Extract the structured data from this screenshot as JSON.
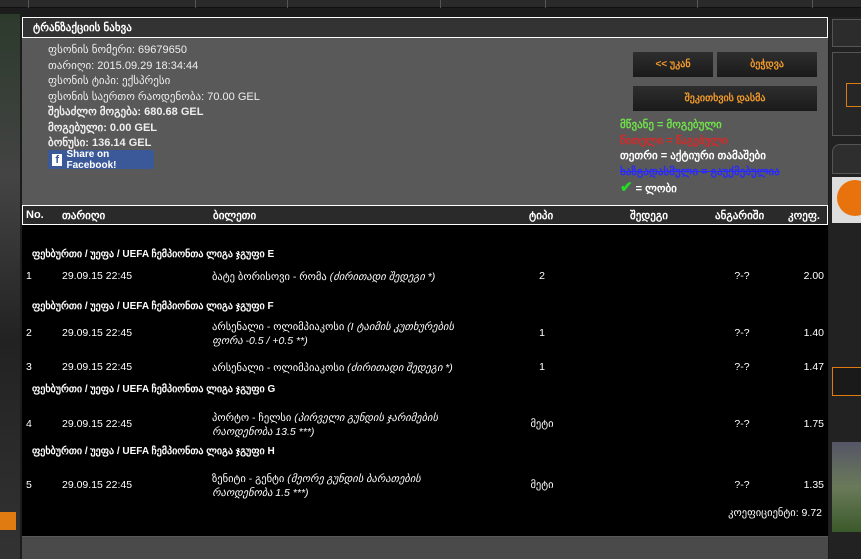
{
  "panel": {
    "title": "ტრანზაქციის ნახვა"
  },
  "info": {
    "bet_number": "ფსონის ნომერი: 69679650",
    "date": "თარიღი: 2015.09.29 18:34:44",
    "bet_type": "ფსონის ტიპი: ექსპრესი",
    "total_amount": "ფსონის საერთო რაოდენობა: 70.00 GEL",
    "possible_win": "შესაძლო მოგება: 680.68 GEL",
    "won": "მოგებული: 0.00 GEL",
    "bonus": "ბონუსი: 136.14 GEL"
  },
  "share_label": "Share on Facebook!",
  "buttons": {
    "back": "<< უკან",
    "print": "ბეჭდვა",
    "ask": "შეკითხვის დასმა"
  },
  "legend": {
    "green": "მწვანე = მოგებული",
    "red": "წითელი = წაგებული",
    "white": "თეთრი = აქტიური თამაშები",
    "blue": "ხაზგადასმული = გაუქმებულია",
    "check": "= ლობი"
  },
  "colors": {
    "accent": "#f39b2a",
    "green": "#6fe04a",
    "red": "#d42a2a",
    "blue": "#2a2aff"
  },
  "table": {
    "headers": [
      "No.",
      "თარიღი",
      "ბილეთი",
      "ტიპი",
      "შედეგი",
      "ანგარიში",
      "კოეფ."
    ],
    "groups": [
      "ფეხბურთი / უეფა / UEFA ჩემპიონთა ლიგა ჯგუფი E",
      "ფეხბურთი / უეფა / UEFA ჩემპიონთა ლიგა ჯგუფი F",
      "ფეხბურთი / უეფა / UEFA ჩემპიონთა ლიგა ჯგუფი G",
      "ფეხბურთი / უეფა / UEFA ჩემპიონთა ლიგა ჯგუფი H"
    ],
    "rows": [
      {
        "no": "1",
        "date": "29.09.15 22:45",
        "match": "ბატე ბორისოვი - რომა",
        "market": "(ძირითადი შედეგი *)",
        "type": "2",
        "score": "?-?",
        "odds": "2.00"
      },
      {
        "no": "2",
        "date": "29.09.15 22:45",
        "match": "არსენალი - ოლიმპიაკოსი",
        "market": "(I ტაიმის კუთხურების ფორა -0.5 / +0.5 **)",
        "type": "1",
        "score": "?-?",
        "odds": "1.40"
      },
      {
        "no": "3",
        "date": "29.09.15 22:45",
        "match": "არსენალი - ოლიმპიაკოსი",
        "market": "(ძირითადი შედეგი *)",
        "type": "1",
        "score": "?-?",
        "odds": "1.47"
      },
      {
        "no": "4",
        "date": "29.09.15 22:45",
        "match": "პორტო - ჩელსი",
        "market": "(პირველი გუნდის ჯარიმების რაოდენობა 13.5 ***)",
        "type": "მეტი",
        "score": "?-?",
        "odds": "1.75"
      },
      {
        "no": "5",
        "date": "29.09.15 22:45",
        "match": "ზენიტი - გენტი",
        "market": "(მეორე გუნდის ბარათების რაოდენობა 1.5 ***)",
        "type": "მეტი",
        "score": "?-?",
        "odds": "1.35"
      }
    ],
    "total": "კოეფიციენტი: 9.72"
  }
}
